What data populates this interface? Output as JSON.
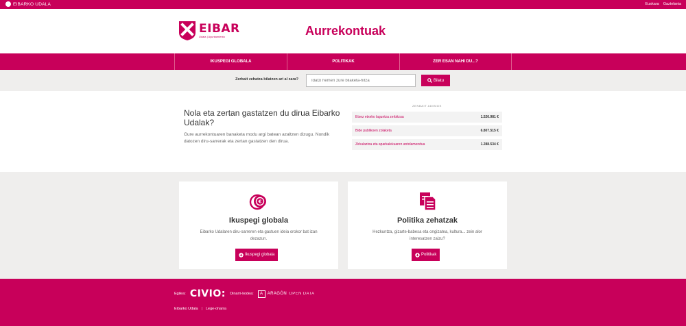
{
  "topbar": {
    "org": "EIBARKO UDALA",
    "lang_eu": "Euskara",
    "lang_es": "Gaztelania"
  },
  "header": {
    "brand_name": "EIBAR",
    "brand_sub": "Udala | Ayuntamiento",
    "page_title": "Aurrekontuak"
  },
  "nav": {
    "tabs": [
      {
        "label": "IKUSPEGI GLOBALA"
      },
      {
        "label": "POLITIKAK"
      },
      {
        "label": "ZER ESAN NAHI DU...?"
      }
    ]
  },
  "search": {
    "label": "Zerbait zehatza bilatzen ari al zara?",
    "placeholder": "Idatzi hemen zure bilaketa-hitza",
    "button": "Bilatu"
  },
  "intro": {
    "title": "Nola eta zertan gastatzen du dirua Eibarko Udalak?",
    "text": "Gure aurrekontuaren banaketa modu argi batean azaltzen dizugu. Nondik datozen diru-sarrerak eta zertan gastatzen den dirua."
  },
  "examples": {
    "heading": "ZENBAIT ADIBIDE",
    "rows": [
      {
        "name": "Etxez etxeko laguntza zerbitzua",
        "amount": "1.526.981 €"
      },
      {
        "name": "Bide publikoen zolaketa",
        "amount": "6.807.515 €"
      },
      {
        "name": "Zirkulazioa eta aparkalekuaren antolamendua",
        "amount": "1.288.534 €"
      }
    ]
  },
  "cards": {
    "global": {
      "title": "Ikuspegi globala",
      "text": "Eibarko Udalaren diru-sarreren eta gastuen ideia orokor bat izan dezazun.",
      "button": "Ikuspegi globala"
    },
    "policies": {
      "title": "Politika zehatzak",
      "text": "Hezkuntza, gizarte-babesa eta ongizatea, kultura... zein alor interesatzen zaizu?",
      "button": "Politikak"
    }
  },
  "footer": {
    "by_label": "Egilea:",
    "civio": "CIVIO:",
    "source_label": "Oinarri-kodea:",
    "aragon": "ARAGÓN",
    "aragon_sub": "OPEN DATA",
    "link_council": "Eibarko Udala",
    "link_legal": "Lege-oharra"
  },
  "colors": {
    "accent": "#c8005a",
    "background_gray": "#efeeed"
  }
}
